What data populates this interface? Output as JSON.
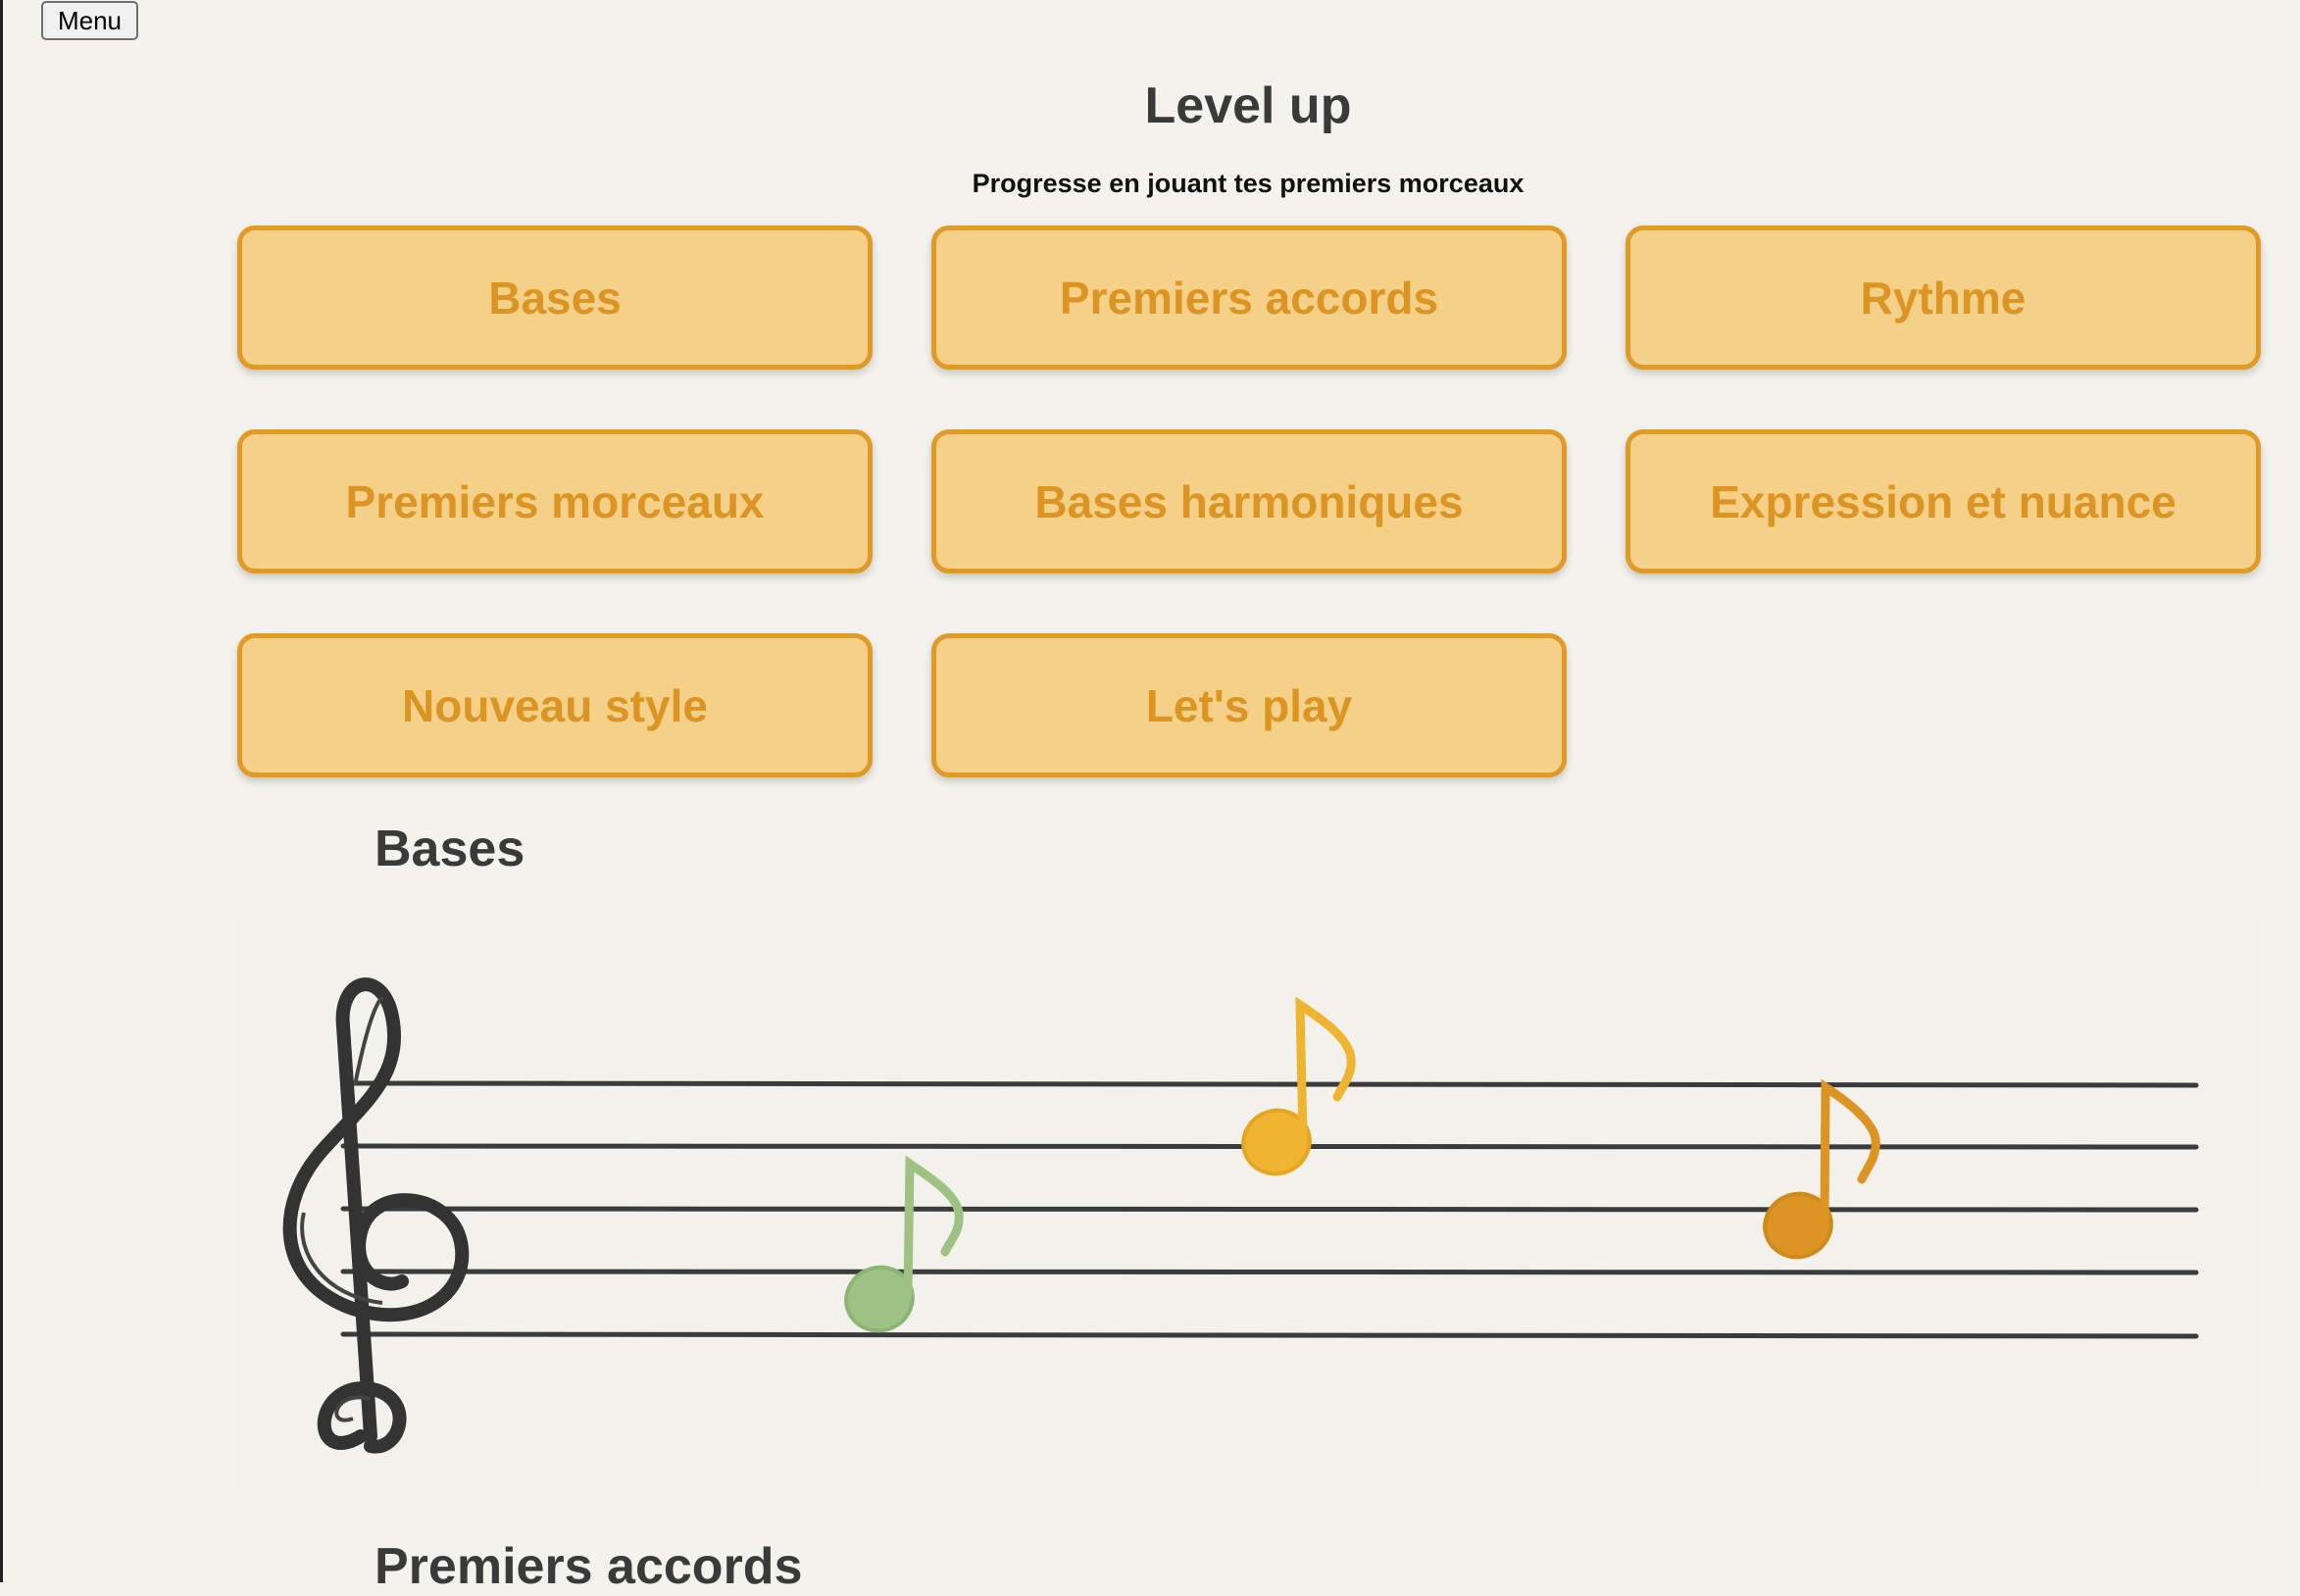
{
  "menu": {
    "label": "Menu"
  },
  "page": {
    "title": "Level up",
    "subtitle": "Progresse en jouant tes premiers morceaux"
  },
  "levels": [
    {
      "label": "Bases"
    },
    {
      "label": "Premiers accords"
    },
    {
      "label": "Rythme"
    },
    {
      "label": "Premiers morceaux"
    },
    {
      "label": "Bases harmoniques"
    },
    {
      "label": "Expression et nuance"
    },
    {
      "label": "Nouveau style"
    },
    {
      "label": "Let's play"
    }
  ],
  "sections": [
    {
      "heading": "Bases"
    },
    {
      "heading": "Premiers accords"
    }
  ],
  "illustration": {
    "icon": "treble-clef-staff-icon",
    "note_colors": [
      "#9dc283",
      "#efb430",
      "#dc9423"
    ]
  },
  "colors": {
    "background": "#f3f2ec",
    "card_fill": "#f4d089",
    "card_border": "#e19a25",
    "card_text": "#dc9423",
    "heading": "#3a3a3a"
  }
}
